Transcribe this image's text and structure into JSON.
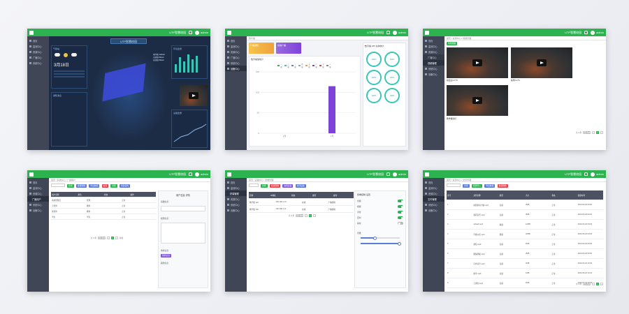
{
  "header": {
    "title": "UTP智慧校园",
    "user": "admin"
  },
  "menu": [
    "首页",
    "监测中心",
    "资源中心",
    "广播中心",
    "系统中心",
    "设备中心"
  ],
  "dashboard": {
    "banner": "UTP智慧校园",
    "weather_title": "气象站",
    "weather_date": "3月18日",
    "panel_right_1": "环境监测",
    "panel_right_2": "设备监测",
    "panel_left_2": "通知消息",
    "legend": [
      "教学楼 120kwh",
      "实验楼 80kwh",
      "宿舍楼 60kwh"
    ]
  },
  "broadcast": {
    "tab": "数字播",
    "cards": [
      "广播通知",
      "系统广播"
    ],
    "section": "数字播放统计",
    "legend": [
      "一级",
      "二级",
      "三级",
      "四级",
      "五级",
      "六级",
      "七级",
      "八级"
    ],
    "right_title": "数字播 365 总体统计",
    "circles": [
      "100%",
      "100%",
      "100%",
      "100%",
      "100%",
      "100%"
    ],
    "yaxis": [
      "150",
      "100",
      "50",
      "0"
    ],
    "xlabels": [
      "1月",
      "2月"
    ],
    "bars": [
      {
        "value": 0
      },
      {
        "value": 115
      }
    ],
    "ymax": 150
  },
  "video": {
    "button": "新增视频",
    "crumb": [
      "首页",
      "资源中心",
      "视频管理"
    ],
    "captions": [
      "校园主CCTV",
      "操场CCTV",
      "教学楼监控"
    ],
    "pager_total": "共 3 条",
    "page_size": "10条/页",
    "page": "1"
  },
  "users": {
    "crumb": [
      "首页",
      "系统中心",
      "广播用户"
    ],
    "buttons": [
      "新增",
      "批量删除",
      "导出数据",
      "启用",
      "禁用",
      "重置密码"
    ],
    "headers": [
      "用户名称",
      "角色",
      "状态",
      "操作"
    ],
    "rows": [
      [
        "系统管理员",
        "管理",
        "正常"
      ],
      [
        "王老师",
        "教师",
        "正常"
      ],
      [
        "张老师",
        "教师",
        "正常"
      ],
      [
        "学生",
        "学生",
        "正常"
      ]
    ],
    "detail_title": "用户信息 详情",
    "detail_sections": [
      "基础信息",
      "权限信息",
      "角色信息",
      "其他信息"
    ],
    "pager_total": "共 4 条",
    "page_size": "10条/页",
    "page": "1",
    "goto": "前往"
  },
  "devices": {
    "crumb": [
      "首页",
      "设备中心",
      "终端管理"
    ],
    "buttons": [
      "新增",
      "批量删除",
      "启用设备",
      "关闭设备"
    ],
    "headers": [
      "名称",
      "IP地址",
      "状态",
      "类型",
      "操作"
    ],
    "rows": [
      [
        "教学楼 101",
        "192.168.1.10",
        "在线",
        "广播终端"
      ],
      [
        "教学楼 102",
        "192.168.1.11",
        "在线",
        "广播终端"
      ]
    ],
    "right_title": "终端控制 设置",
    "switches": [
      {
        "label": "音频",
        "on": true
      },
      {
        "label": "视频",
        "on": true
      },
      {
        "label": "录音",
        "on": true
      },
      {
        "label": "定时",
        "on": true
      },
      {
        "label": "静音",
        "on": false
      }
    ],
    "volume_label": "音量",
    "pager_total": "共 2 条",
    "page_size": "10条/页",
    "page": "1"
  },
  "list": {
    "crumb": [
      "首页",
      "资源中心",
      "文件管理"
    ],
    "buttons": [
      "新增",
      "批量导入",
      "导出数据",
      "批量删除"
    ],
    "headers": [
      "序号",
      "文件名称",
      "类型",
      "大小",
      "状态",
      "创建时间"
    ],
    "rows": [
      [
        "1",
        "校园新闻广播.mp3",
        "音频",
        "2MB",
        "正常",
        "2023-03-18 09:00"
      ],
      [
        "2",
        "课间音乐.mp3",
        "音频",
        "3MB",
        "正常",
        "2023-03-18 09:10"
      ],
      [
        "3",
        "upload.mp4",
        "视频",
        "12MB",
        "正常",
        "2023-03-18 09:20"
      ],
      [
        "4",
        "升旗仪式.mp4",
        "视频",
        "20MB",
        "正常",
        "2023-03-18 09:30"
      ],
      [
        "5",
        "通知.mp3",
        "音频",
        "1MB",
        "正常",
        "2023-03-18 09:40"
      ],
      [
        "6",
        "眼保健操.mp3",
        "音频",
        "2MB",
        "正常",
        "2023-03-18 09:50"
      ],
      [
        "7",
        "午休铃声.mp3",
        "音频",
        "1MB",
        "正常",
        "2023-03-18 10:00"
      ],
      [
        "8",
        "放学.mp3",
        "音频",
        "1MB",
        "正常",
        "2023-03-18 10:10"
      ],
      [
        "9",
        "上课铃.mp3",
        "音频",
        "1MB",
        "正常",
        "2023-03-18 10:20"
      ]
    ],
    "pager_total": "共 9 条",
    "page_size": "10条/页",
    "page": "1"
  },
  "colors": {
    "accent": "#2cb24f",
    "sidebar": "#404656",
    "dark_bg": "#1d2c45",
    "bar": "#7d43d8"
  }
}
